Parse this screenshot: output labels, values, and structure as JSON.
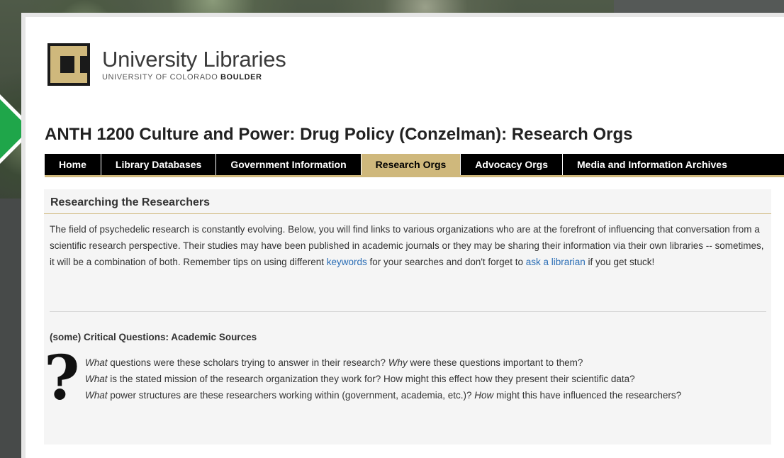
{
  "logo": {
    "title": "University Libraries",
    "subtitle_regular": "UNIVERSITY OF COLORADO ",
    "subtitle_bold": "BOULDER"
  },
  "page_title": "ANTH 1200 Culture and Power: Drug Policy (Conzelman): Research Orgs",
  "nav": [
    {
      "label": "Home",
      "active": false
    },
    {
      "label": "Library Databases",
      "active": false
    },
    {
      "label": "Government Information",
      "active": false
    },
    {
      "label": "Research Orgs",
      "active": true
    },
    {
      "label": "Advocacy Orgs",
      "active": false
    },
    {
      "label": "Media and Information Archives",
      "active": false
    }
  ],
  "section": {
    "header": "Researching the Researchers",
    "para_1": "The field of psychedelic research is constantly evolving. Below, you will find links to various organizations who are at the forefront of influencing that conversation from a scientific research perspective. Their studies may have been published in academic journals or they may be sharing their information via their own libraries -- sometimes, it will be a combination of both. Remember tips on using different ",
    "link_keywords": "keywords",
    "para_2": " for your searches and don't forget to ",
    "link_librarian": "ask a librarian",
    "para_3": " if you get stuck!",
    "subhead": "(some) Critical Questions: Academic Sources",
    "qmark": "?",
    "questions": [
      {
        "em1": "What",
        "t1": " questions were these scholars trying to answer in their research? ",
        "em2": "Why",
        "t2": " were these questions important to them?"
      },
      {
        "em1": "What",
        "t1": " is the stated mission of the research organization they work for? How might this effect how they present their scientific data?",
        "em2": "",
        "t2": ""
      },
      {
        "em1": "What",
        "t1": " power structures are these researchers working within (government, academia, etc.)? ",
        "em2": "How",
        "t2": " might this have influenced the researchers?"
      }
    ]
  },
  "colors": {
    "nav_bg": "#000000",
    "nav_active": "#cfb87c",
    "link": "#2a6db5",
    "arrow": "#1fa64a"
  }
}
